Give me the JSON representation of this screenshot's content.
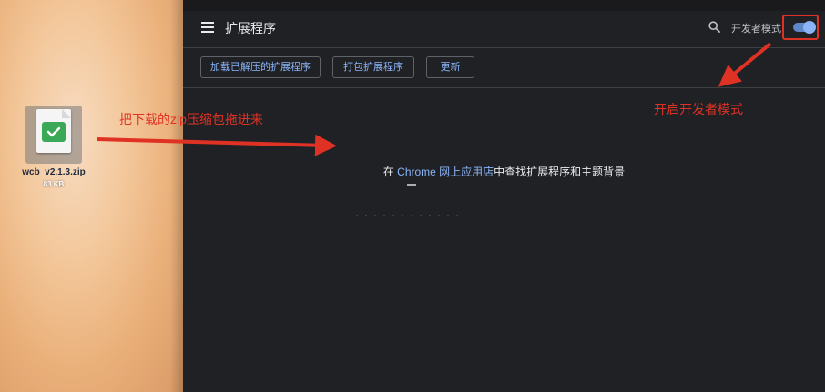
{
  "desktop": {
    "file_name": "wcb_v2.1.3.zip",
    "file_size": "83 KB",
    "file_icon": "zip-archive-icon"
  },
  "extensions_page": {
    "title": "扩展程序",
    "menu_icon": "hamburger-menu-icon",
    "search_icon": "search-icon",
    "developer_mode_label": "开发者模式",
    "developer_mode_on": true,
    "buttons": {
      "load_unpacked": "加载已解压的扩展程序",
      "pack": "打包扩展程序",
      "update": "更新"
    },
    "store_prefix": "在 ",
    "store_link": "Chrome 网上应用店",
    "store_suffix": "中查找扩展程序和主题背景"
  },
  "annotations": {
    "drag_hint": "把下载的zip压缩包拖进来",
    "dev_mode_hint": "开启开发者模式",
    "color": "#e03224"
  },
  "colors": {
    "page_bg": "#202124",
    "link": "#8ab4f8",
    "accent_red": "#e03224"
  }
}
